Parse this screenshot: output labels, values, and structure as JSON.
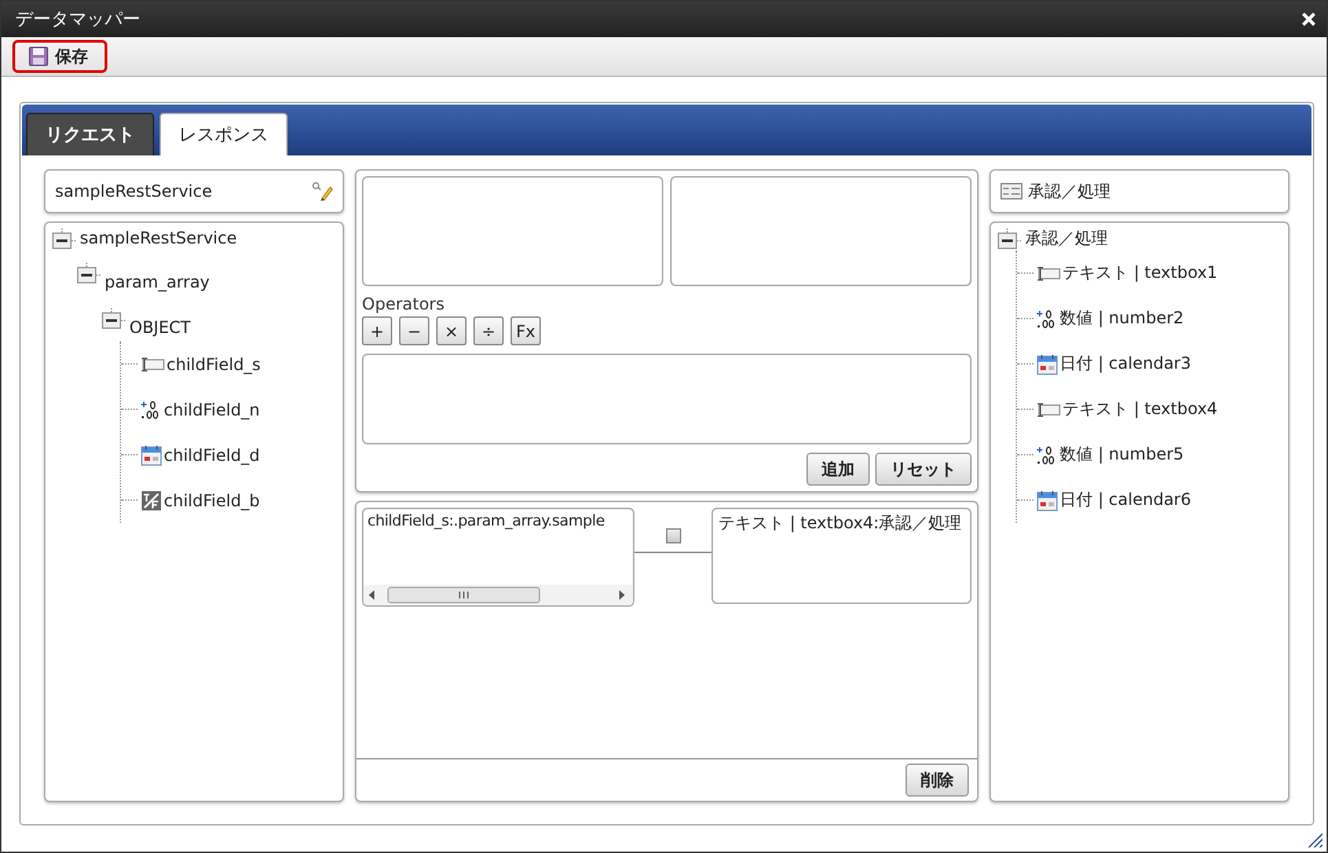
{
  "window": {
    "title": "データマッパー"
  },
  "toolbar": {
    "save_button": {
      "label": "保存",
      "highlighted": true
    }
  },
  "tabs": [
    {
      "label": "リクエスト",
      "selected": false
    },
    {
      "label": "レスポンス",
      "selected": true
    }
  ],
  "source": {
    "title": "sampleRestService",
    "tree": [
      {
        "label": "sampleRestService",
        "kind": "object",
        "expanded": true,
        "children": [
          {
            "label": "param_array",
            "kind": "object",
            "expanded": true,
            "children": [
              {
                "label": "OBJECT",
                "kind": "object",
                "expanded": true,
                "children": [
                  {
                    "label": "childField_s",
                    "kind": "text"
                  },
                  {
                    "label": "childField_n",
                    "kind": "number"
                  },
                  {
                    "label": "childField_d",
                    "kind": "date"
                  },
                  {
                    "label": "childField_b",
                    "kind": "boolean"
                  }
                ]
              }
            ]
          }
        ]
      }
    ]
  },
  "expression": {
    "operators_label": "Operators",
    "operators": [
      "+",
      "−",
      "×",
      "÷",
      "Fx"
    ],
    "buttons": [
      "追加",
      "リセット"
    ]
  },
  "mappings": [
    {
      "source": "childField_s:.param_array.sample",
      "target": "テキスト | textbox4:承認／処理",
      "checked": false
    }
  ],
  "delete_button": "削除",
  "target": {
    "title": "承認／処理",
    "tree": [
      {
        "label": "承認／処理",
        "kind": "object",
        "expanded": true,
        "children": [
          {
            "label": "テキスト | textbox1",
            "kind": "text"
          },
          {
            "label": "数値 | number2",
            "kind": "number"
          },
          {
            "label": "日付 | calendar3",
            "kind": "date"
          },
          {
            "label": "テキスト | textbox4",
            "kind": "text"
          },
          {
            "label": "数値 | number5",
            "kind": "number"
          },
          {
            "label": "日付 | calendar6",
            "kind": "date"
          }
        ]
      }
    ]
  }
}
